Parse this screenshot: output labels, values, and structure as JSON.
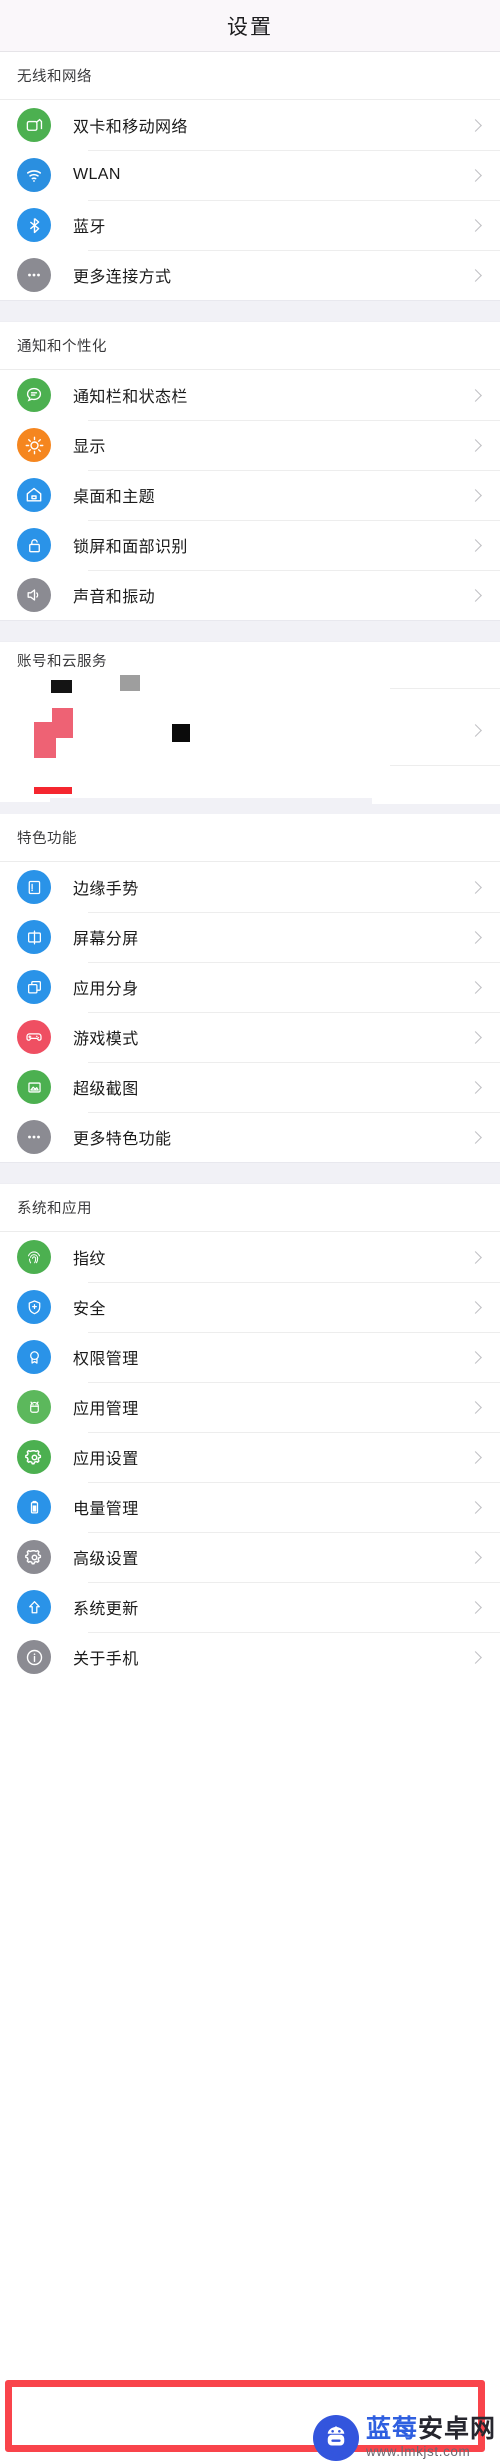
{
  "header": {
    "title": "设置"
  },
  "sections": [
    {
      "id": "wireless",
      "title": "无线和网络",
      "items": [
        {
          "label": "双卡和移动网络",
          "icon": "sim-card-icon",
          "color": "#4cb050"
        },
        {
          "label": "WLAN",
          "icon": "wifi-icon",
          "color": "#2a8fe0"
        },
        {
          "label": "蓝牙",
          "icon": "bluetooth-icon",
          "color": "#2a93e8"
        },
        {
          "label": "更多连接方式",
          "icon": "more-dots-icon",
          "color": "#8b8b92"
        }
      ]
    },
    {
      "id": "notification",
      "title": "通知和个性化",
      "items": [
        {
          "label": "通知栏和状态栏",
          "icon": "chat-bubble-icon",
          "color": "#4cb050"
        },
        {
          "label": "显示",
          "icon": "brightness-icon",
          "color": "#f5861f"
        },
        {
          "label": "桌面和主题",
          "icon": "home-icon",
          "color": "#2a93e8"
        },
        {
          "label": "锁屏和面部识别",
          "icon": "lock-icon",
          "color": "#2a93e8"
        },
        {
          "label": "声音和振动",
          "icon": "speaker-icon",
          "color": "#8b8b92"
        }
      ]
    },
    {
      "id": "account",
      "title": "账号和云服务",
      "corrupted": true,
      "items": []
    },
    {
      "id": "features",
      "title": "特色功能",
      "items": [
        {
          "label": "边缘手势",
          "icon": "edge-gesture-icon",
          "color": "#2a93e8"
        },
        {
          "label": "屏幕分屏",
          "icon": "split-screen-icon",
          "color": "#2a93e8"
        },
        {
          "label": "应用分身",
          "icon": "app-clone-icon",
          "color": "#2a93e8"
        },
        {
          "label": "游戏模式",
          "icon": "gamepad-icon",
          "color": "#ef4f62"
        },
        {
          "label": "超级截图",
          "icon": "screenshot-icon",
          "color": "#4cb050"
        },
        {
          "label": "更多特色功能",
          "icon": "more-dots-icon",
          "color": "#8b8b92"
        }
      ]
    },
    {
      "id": "system",
      "title": "系统和应用",
      "items": [
        {
          "label": "指纹",
          "icon": "fingerprint-icon",
          "color": "#4cb050"
        },
        {
          "label": "安全",
          "icon": "shield-icon",
          "color": "#2a93e8"
        },
        {
          "label": "权限管理",
          "icon": "badge-icon",
          "color": "#2a93e8"
        },
        {
          "label": "应用管理",
          "icon": "android-icon",
          "color": "#5cb85c"
        },
        {
          "label": "应用设置",
          "icon": "gear-icon",
          "color": "#4cb050"
        },
        {
          "label": "电量管理",
          "icon": "battery-icon",
          "color": "#2a93e8"
        },
        {
          "label": "高级设置",
          "icon": "gear-icon",
          "color": "#8b8b92"
        },
        {
          "label": "系统更新",
          "icon": "up-arrow-icon",
          "color": "#2a93e8"
        },
        {
          "label": "关于手机",
          "icon": "info-icon",
          "color": "#8b8b92",
          "highlighted": true
        }
      ]
    }
  ],
  "highlight": {
    "color": "#f9444b"
  },
  "watermark": {
    "brand_blue": "蓝莓",
    "brand_dark": "安卓网",
    "url": "www.lmkjst.com",
    "logo": "android-mascot-icon"
  }
}
